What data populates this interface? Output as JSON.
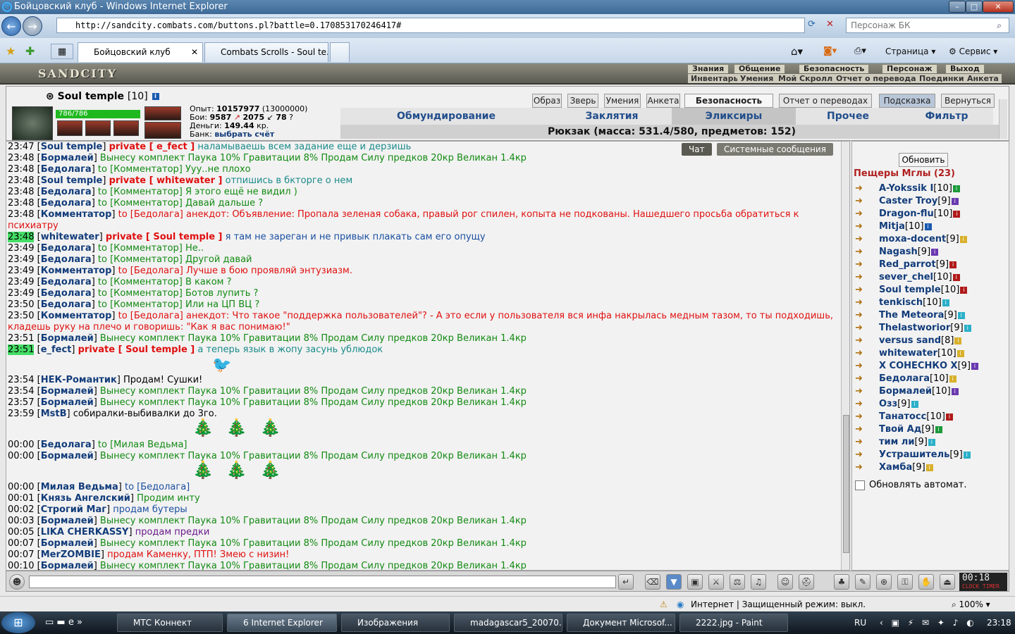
{
  "window": {
    "title": "Бойцовский клуб - Windows Internet Explorer"
  },
  "browser": {
    "url": "http://sandcity.combats.com/buttons.pl?battle=0.170853170246417#",
    "search_placeholder": "Персонаж БК",
    "tabs": [
      "Бойцовский клуб",
      "Combats Scrolls - Soul te..."
    ],
    "tools": [
      "Страница",
      "Сервис"
    ]
  },
  "game": {
    "logo": "SANDCITY",
    "menu_top": [
      "Знания",
      "Общение",
      "Безопасность",
      "Персонаж",
      "Выход"
    ],
    "menu_bottom": [
      "Инвентарь",
      "Умения",
      "Мой Скролл",
      "Отчет о переводах",
      "Поединки",
      "Анкета"
    ],
    "char": {
      "name": "Soul temple",
      "level": "[10]",
      "hp": "786/786",
      "exp_label": "Опыт:",
      "exp": "10157977",
      "exp_next": "(13000000)",
      "fights_label": "Бои:",
      "wins": "9587",
      "losses": "2075",
      "draws": "78",
      "money_label": "Деньги:",
      "money": "149.44",
      "money_unit": "кр.",
      "bank_label": "Банк:",
      "bank": "выбрать счёт"
    },
    "buttons": [
      "Образ",
      "Зверь",
      "Умения",
      "Анкета",
      "Безопасность",
      "Отчет о переводах",
      "Подсказка",
      "Вернуться"
    ],
    "inv_tabs": [
      "Обмундирование",
      "Заклятия",
      "Эликсиры",
      "Прочее",
      "Фильтр"
    ],
    "backpack": "Рюкзак (масса: 531.4/580, предметов: 152)",
    "chat_tabs": [
      "Чат",
      "Системные сообщения"
    ],
    "chat": [
      {
        "t": "23:47",
        "n": "Soul temple",
        "p": "private [ e_fect ]",
        "m": "наламываешь всем задание еще и дерзишь",
        "c": "teal"
      },
      {
        "t": "23:48",
        "n": "Бормалей",
        "m": "Вынесу комплект Паука 10% Гравитации 8% Продам Силу предков 20кр Великан 1.4кр",
        "c": "green"
      },
      {
        "t": "23:48",
        "n": "Бедолага",
        "m": "to [Комментатор] Ууу..не плохо",
        "c": "green"
      },
      {
        "t": "23:48",
        "n": "Soul temple",
        "p": "private [ whitewater ]",
        "m": "отпишись в бкторге о нем",
        "c": "teal"
      },
      {
        "t": "23:48",
        "n": "Бедолага",
        "m": "to [Комментатор] Я этого ещё не видил )",
        "c": "green"
      },
      {
        "t": "23:48",
        "n": "Бедолага",
        "m": "to [Комментатор] Давай дальше ?",
        "c": "green"
      },
      {
        "t": "23:48",
        "n": "Комментатор",
        "m": "to [Бедолага] анекдот: Объявление: Пропала зеленая собака, правый рог спилен, копыта не подкованы. Нашедшего просьба обратиться к",
        "c": "red"
      },
      {
        "t": "",
        "n": "",
        "m": "психиатру",
        "c": "red"
      },
      {
        "t": "23:48",
        "n": "whitewater",
        "p": "private [ Soul temple ]",
        "m": "я там не зареган и не привык плакать сам его опущу",
        "c": "blue",
        "hl": true
      },
      {
        "t": "23:49",
        "n": "Бедолага",
        "m": "to [Комментатор] Не..",
        "c": "green"
      },
      {
        "t": "23:49",
        "n": "Бедолага",
        "m": "to [Комментатор] Другой давай",
        "c": "green"
      },
      {
        "t": "23:49",
        "n": "Комментатор",
        "m": "to [Бедолага] Лучше в бою проявляй энтузиазм.",
        "c": "red"
      },
      {
        "t": "23:49",
        "n": "Бедолага",
        "m": "to [Комментатор] В каком ?",
        "c": "green"
      },
      {
        "t": "23:49",
        "n": "Бедолага",
        "m": "to [Комментатор] Ботов лупить ?",
        "c": "green"
      },
      {
        "t": "23:50",
        "n": "Бедолага",
        "m": "to [Комментатор] Или на ЦП ВЦ ?",
        "c": "green"
      },
      {
        "t": "23:50",
        "n": "Комментатор",
        "m": "to [Бедолага] анекдот: Что такое \"поддержка пользователей\"? - А это если у пользователя вся инфа накрылась медным тазом, то ты подходишь,",
        "c": "red"
      },
      {
        "t": "",
        "n": "",
        "m": "кладешь руку на плечо и говоришь: \"Как я вас понимаю!\"",
        "c": "red"
      },
      {
        "t": "23:51",
        "n": "Бормалей",
        "m": "Вынесу комплект Паука 10% Гравитации 8% Продам Силу предков 20кр Великан 1.4кр",
        "c": "green"
      },
      {
        "t": "23:51",
        "n": "e_fect",
        "p": "private [ Soul temple ]",
        "m": "а теперь язык в жопу засунь ублюдок",
        "c": "teal",
        "hl": true
      },
      {
        "t": "23:54",
        "n": "НЕК-Романтик",
        "m": "Продам! Сушки!",
        "c": "t"
      },
      {
        "t": "23:54",
        "n": "Бормалей",
        "m": "Вынесу комплект Паука 10% Гравитации 8% Продам Силу предков 20кр Великан 1.4кр",
        "c": "green"
      },
      {
        "t": "23:57",
        "n": "Бормалей",
        "m": "Вынесу комплект Паука 10% Гравитации 8% Продам Силу предков 20кр Великан 1.4кр",
        "c": "green"
      },
      {
        "t": "23:59",
        "n": "MstB",
        "m": "собиралки-выбивалки до 3го.",
        "c": "t"
      },
      {
        "t": "00:00",
        "n": "Бедолага",
        "m": "to [Милая Ведьма]",
        "c": "green"
      },
      {
        "t": "00:00",
        "n": "Бормалей",
        "m": "Вынесу комплект Паука 10% Гравитации 8% Продам Силу предков 20кр Великан 1.4кр",
        "c": "green"
      },
      {
        "t": "00:00",
        "n": "Милая Ведьма",
        "m": "to [Бедолага]",
        "c": "blue"
      },
      {
        "t": "00:01",
        "n": "Князь Ангелский",
        "m": "Продим инту",
        "c": "green"
      },
      {
        "t": "00:02",
        "n": "Строгий Маг",
        "m": "продам бутеры",
        "c": "blue"
      },
      {
        "t": "00:03",
        "n": "Бормалей",
        "m": "Вынесу комплект Паука 10% Гравитации 8% Продам Силу предков 20кр Великан 1.4кр",
        "c": "green"
      },
      {
        "t": "00:05",
        "n": "LIKA CHERKASSY",
        "m": "продам предки",
        "c": "purple"
      },
      {
        "t": "00:07",
        "n": "Бормалей",
        "m": "Вынесу комплект Паука 10% Гравитации 8% Продам Силу предков 20кр Великан 1.4кр",
        "c": "green"
      },
      {
        "t": "00:07",
        "n": "MerZOMBIE",
        "m": "продам Каменку, ПТП! Змею с низин!",
        "c": "red"
      },
      {
        "t": "00:10",
        "n": "Бормалей",
        "m": "Вынесу комплект Паука 10% Гравитации 8% Продам Силу предков 20кр Великан 1.4кр",
        "c": "green"
      }
    ],
    "room": {
      "refresh": "Обновить",
      "title": "Пещеры Мглы (23)",
      "auto": "Обновлять автомат.",
      "users": [
        {
          "n": "A-Yokssik I",
          "l": "[10]",
          "i": "#1a9a3a"
        },
        {
          "n": "Caster Troy",
          "l": "[9]",
          "i": "#6a3ab0"
        },
        {
          "n": "Dragon-flu",
          "l": "[10]",
          "i": "#b01a1a"
        },
        {
          "n": "Mitja",
          "l": "[10]",
          "i": "#1a5ab0"
        },
        {
          "n": "moxa-docent",
          "l": "[9]",
          "i": "#d8b02a"
        },
        {
          "n": "Nagash",
          "l": "[9]",
          "i": "#6a3ab0"
        },
        {
          "n": "Red_parrot",
          "l": "[9]",
          "i": "#b01a1a"
        },
        {
          "n": "sever_chel",
          "l": "[10]",
          "i": "#b01a1a"
        },
        {
          "n": "Soul temple",
          "l": "[10]",
          "i": "#b01a1a"
        },
        {
          "n": "tenkisch",
          "l": "[10]",
          "i": "#2ab0c8"
        },
        {
          "n": "The Meteora",
          "l": "[9]",
          "i": "#2ab0c8"
        },
        {
          "n": "Thelastworior",
          "l": "[9]",
          "i": "#2ab0c8"
        },
        {
          "n": "versus sand",
          "l": "[8]",
          "i": "#d8b02a"
        },
        {
          "n": "whitewater",
          "l": "[10]",
          "i": "#d8b02a"
        },
        {
          "n": "X СОНЕСНКО X",
          "l": "[9]",
          "i": "#6a3ab0"
        },
        {
          "n": "Бедолага",
          "l": "[10]",
          "i": "#d8b02a"
        },
        {
          "n": "Бормалей",
          "l": "[10]",
          "i": "#6a3ab0"
        },
        {
          "n": "Озз",
          "l": "[9]",
          "i": "#2ab0c8"
        },
        {
          "n": "Танатосс",
          "l": "[10]",
          "i": "#b01a1a"
        },
        {
          "n": "Твой Ад",
          "l": "[9]",
          "i": "#1a9a3a"
        },
        {
          "n": "тим ли",
          "l": "[9]",
          "i": "#2ab0c8"
        },
        {
          "n": "Устрашитель",
          "l": "[9]",
          "i": "#2ab0c8"
        },
        {
          "n": "Хамба",
          "l": "[9]",
          "i": "#d8b02a"
        }
      ]
    },
    "clock": "00:18"
  },
  "statusbar": {
    "zone": "Интернет | Защищенный режим: выкл.",
    "zoom": "100%"
  },
  "taskbar": {
    "items": [
      "МТС Коннект",
      "6 Internet Explorer",
      "Изображения",
      "madagascar5_20070...",
      "Документ Microsof...",
      "2222.jpg - Paint"
    ],
    "lang": "RU",
    "time": "23:18"
  }
}
